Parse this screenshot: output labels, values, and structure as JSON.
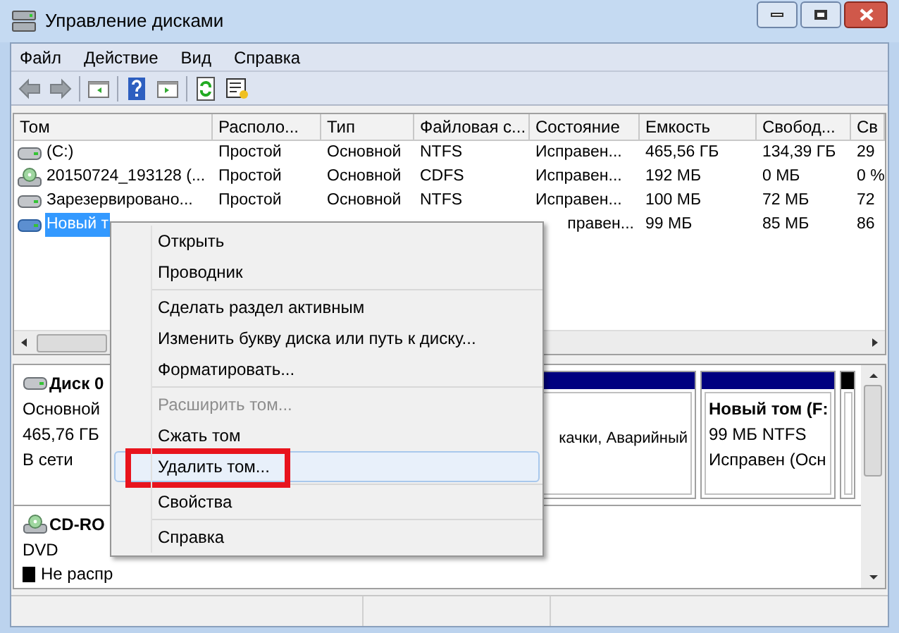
{
  "window": {
    "title": "Управление дисками"
  },
  "menubar": [
    {
      "label": "Файл"
    },
    {
      "label": "Действие"
    },
    {
      "label": "Вид"
    },
    {
      "label": "Справка"
    }
  ],
  "volumes": {
    "columns": [
      "Том",
      "Располо...",
      "Тип",
      "Файловая с...",
      "Состояние",
      "Емкость",
      "Свобод...",
      "Св"
    ],
    "rows": [
      {
        "kind": "disk",
        "selected": false,
        "cells": [
          "(C:)",
          "Простой",
          "Основной",
          "NTFS",
          "Исправен...",
          "465,56 ГБ",
          "134,39 ГБ",
          "29"
        ]
      },
      {
        "kind": "cd",
        "selected": false,
        "cells": [
          "20150724_193128 (...",
          "Простой",
          "Основной",
          "CDFS",
          "Исправен...",
          "192 МБ",
          "0 МБ",
          "0 %"
        ]
      },
      {
        "kind": "disk",
        "selected": false,
        "cells": [
          "Зарезервировано...",
          "Простой",
          "Основной",
          "NTFS",
          "Исправен...",
          "100 МБ",
          "72 МБ",
          "72"
        ]
      },
      {
        "kind": "disk",
        "selected": true,
        "cells": [
          "Новый т",
          "",
          "",
          "",
          "правен...",
          "99 МБ",
          "85 МБ",
          "86"
        ]
      }
    ]
  },
  "disks": [
    {
      "kind": "disk",
      "name": "Диск 0",
      "lines": [
        "Основной",
        "465,76 ГБ",
        "В сети"
      ],
      "partitions": [
        {
          "color": "#000080",
          "lines": [
            "качки, Аварийный"
          ]
        },
        {
          "color": "#000080",
          "title": "Новый том  (F:",
          "lines": [
            "99 МБ NTFS",
            "Исправен (Осн"
          ]
        },
        {
          "color": "#000000"
        }
      ]
    },
    {
      "kind": "cd",
      "name": "CD-RO",
      "lines": [
        "DVD"
      ]
    }
  ],
  "legend": [
    {
      "label": "Не распр",
      "color": "#000000"
    }
  ],
  "context_menu": {
    "sections": [
      [
        {
          "label": "Открыть",
          "disabled": false,
          "selected": false,
          "annotated": false
        },
        {
          "label": "Проводник",
          "disabled": false,
          "selected": false,
          "annotated": false
        }
      ],
      [
        {
          "label": "Сделать раздел активным",
          "disabled": false,
          "selected": false,
          "annotated": false
        },
        {
          "label": "Изменить букву диска или путь к диску...",
          "disabled": false,
          "selected": false,
          "annotated": false
        },
        {
          "label": "Форматировать...",
          "disabled": false,
          "selected": false,
          "annotated": false
        }
      ],
      [
        {
          "label": "Расширить том...",
          "disabled": true,
          "selected": false,
          "annotated": false
        },
        {
          "label": "Сжать том",
          "disabled": false,
          "selected": false,
          "annotated": false
        },
        {
          "label": "Удалить том...",
          "disabled": false,
          "selected": true,
          "annotated": true
        }
      ],
      [
        {
          "label": "Свойства",
          "disabled": false,
          "selected": false,
          "annotated": false
        }
      ],
      [
        {
          "label": "Справка",
          "disabled": false,
          "selected": false,
          "annotated": false
        }
      ]
    ]
  }
}
